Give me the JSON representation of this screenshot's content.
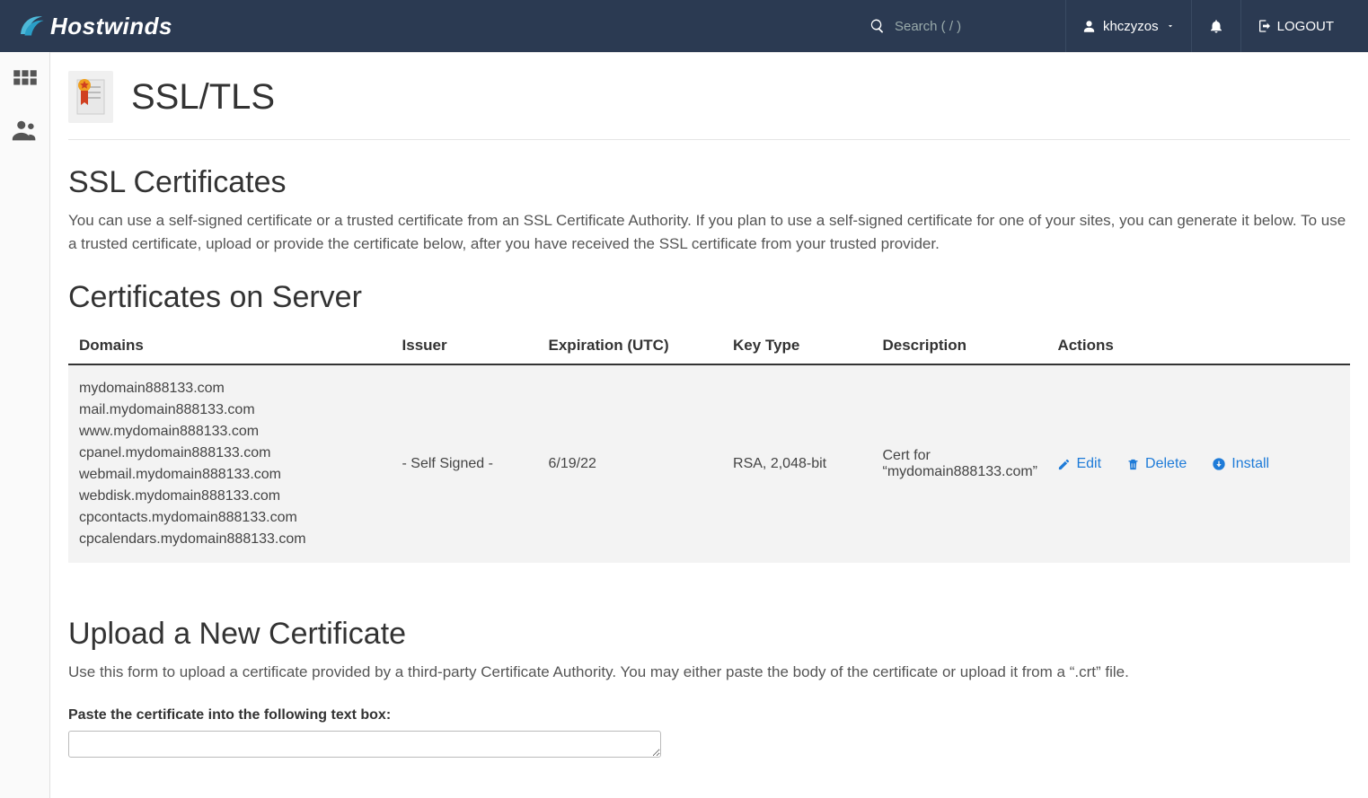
{
  "header": {
    "brand": "Hostwinds",
    "search_placeholder": "Search ( / )",
    "username": "khczyzos",
    "logout_label": "LOGOUT"
  },
  "page": {
    "title": "SSL/TLS"
  },
  "ssl_section": {
    "heading": "SSL Certificates",
    "description": "You can use a self-signed certificate or a trusted certificate from an SSL Certificate Authority. If you plan to use a self-signed certificate for one of your sites, you can generate it below. To use a trusted certificate, upload or provide the certificate below, after you have received the SSL certificate from your trusted provider."
  },
  "certs_section": {
    "heading": "Certificates on Server",
    "columns": {
      "domains": "Domains",
      "issuer": "Issuer",
      "expiration": "Expiration (UTC)",
      "key_type": "Key Type",
      "description": "Description",
      "actions": "Actions"
    },
    "rows": [
      {
        "domains": [
          "mydomain888133.com",
          "mail.mydomain888133.com",
          "www.mydomain888133.com",
          "cpanel.mydomain888133.com",
          "webmail.mydomain888133.com",
          "webdisk.mydomain888133.com",
          "cpcontacts.mydomain888133.com",
          "cpcalendars.mydomain888133.com"
        ],
        "issuer": "- Self Signed -",
        "expiration": "6/19/22",
        "key_type": "RSA, 2,048-bit",
        "description": "Cert for “mydomain888133.com”",
        "actions": {
          "edit": "Edit",
          "delete": "Delete",
          "install": "Install"
        }
      }
    ]
  },
  "upload_section": {
    "heading": "Upload a New Certificate",
    "description": "Use this form to upload a certificate provided by a third-party Certificate Authority. You may either paste the body of the certificate or upload it from a “.crt” file.",
    "paste_label": "Paste the certificate into the following text box:"
  }
}
